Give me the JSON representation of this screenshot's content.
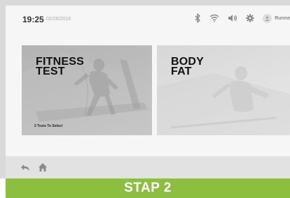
{
  "status_bar": {
    "time": "19:25",
    "date": "02/26/2019",
    "icons": [
      "bluetooth-icon",
      "wifi-icon",
      "volume-icon",
      "settings-gear-icon"
    ],
    "user_name": "Runne"
  },
  "cards": [
    {
      "title_line1": "FITNESS",
      "title_line2": "TEST",
      "subtitle_count": "2",
      "subtitle_text": "Tests To Select"
    },
    {
      "title_line1": "BODY",
      "title_line2": "FAT"
    }
  ],
  "nav": {
    "icons": [
      "back-arrow-icon",
      "home-icon"
    ]
  },
  "banner": {
    "label": "STAP 2",
    "color": "#8cbf3f"
  }
}
